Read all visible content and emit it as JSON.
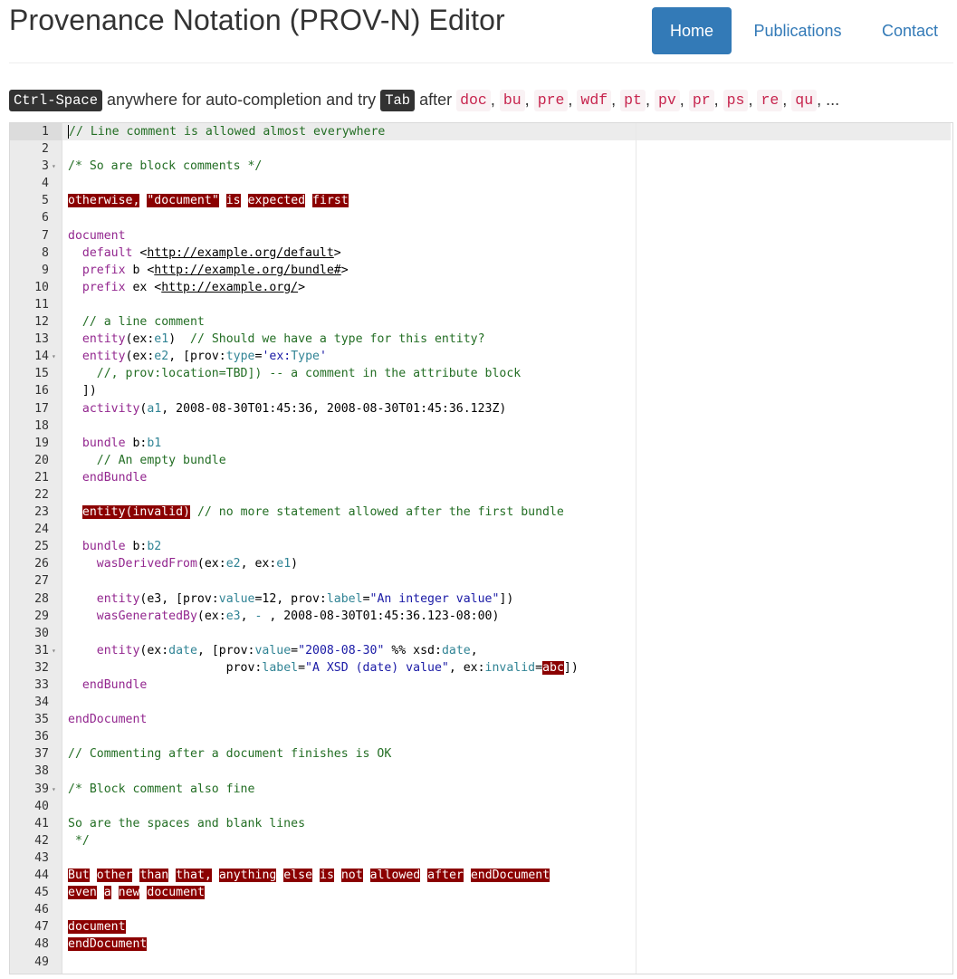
{
  "header": {
    "title": "Provenance Notation (PROV-N) Editor",
    "nav": [
      {
        "label": "Home",
        "active": true
      },
      {
        "label": "Publications",
        "active": false
      },
      {
        "label": "Contact",
        "active": false
      }
    ]
  },
  "hint": {
    "key1": "Ctrl-Space",
    "text1": " anywhere for auto-completion and try ",
    "key2": "Tab",
    "text2": " after ",
    "keywords": [
      "doc",
      "bu",
      "pre",
      "wdf",
      "pt",
      "pv",
      "pr",
      "ps",
      "re",
      "qu"
    ],
    "separator": ",",
    "ellipsis": "..."
  },
  "colors": {
    "accent": "#337ab7",
    "comment": "#236e24",
    "keyword": "#93278f",
    "property": "#318495",
    "string": "#1a1aa6",
    "error_bg": "#8b0000",
    "inline_code": "#c7254e"
  },
  "editor": {
    "fold_markers_on_lines": [
      3,
      14,
      31,
      39
    ],
    "lines": [
      [
        [
          "c",
          "// Line comment is allowed almost everywhere"
        ]
      ],
      [],
      [
        [
          "c",
          "/* So are block comments */"
        ]
      ],
      [],
      [
        [
          "e",
          "otherwise,"
        ],
        [
          "",
          " "
        ],
        [
          "e",
          "\"document\""
        ],
        [
          "",
          " "
        ],
        [
          "e",
          "is"
        ],
        [
          "",
          " "
        ],
        [
          "e",
          "expected"
        ],
        [
          "",
          " "
        ],
        [
          "e",
          "first"
        ]
      ],
      [],
      [
        [
          "k",
          "document"
        ]
      ],
      [
        [
          "",
          "  "
        ],
        [
          "k",
          "default"
        ],
        [
          "",
          " <"
        ],
        [
          "u",
          "http://example.org/default"
        ],
        [
          "",
          ">"
        ]
      ],
      [
        [
          "",
          "  "
        ],
        [
          "k",
          "prefix"
        ],
        [
          "",
          " b <"
        ],
        [
          "u",
          "http://example.org/bundle#"
        ],
        [
          "",
          ">"
        ]
      ],
      [
        [
          "",
          "  "
        ],
        [
          "k",
          "prefix"
        ],
        [
          "",
          " ex <"
        ],
        [
          "u",
          "http://example.org/"
        ],
        [
          "",
          ">"
        ]
      ],
      [],
      [
        [
          "",
          "  "
        ],
        [
          "c",
          "// a line comment"
        ]
      ],
      [
        [
          "",
          "  "
        ],
        [
          "k",
          "entity"
        ],
        [
          "",
          "(ex:"
        ],
        [
          "p",
          "e1"
        ],
        [
          "",
          ")  "
        ],
        [
          "c",
          "// Should we have a type for this entity?"
        ]
      ],
      [
        [
          "",
          "  "
        ],
        [
          "k",
          "entity"
        ],
        [
          "",
          "(ex:"
        ],
        [
          "p",
          "e2"
        ],
        [
          "",
          ", [prov:"
        ],
        [
          "p",
          "type"
        ],
        [
          "",
          "="
        ],
        [
          "s",
          "'ex:"
        ],
        [
          "p",
          "Type"
        ],
        [
          "s",
          "'"
        ]
      ],
      [
        [
          "",
          "    "
        ],
        [
          "c",
          "//, prov:location=TBD]) -- a comment in the attribute block"
        ]
      ],
      [
        [
          "",
          "  ])"
        ]
      ],
      [
        [
          "",
          "  "
        ],
        [
          "k",
          "activity"
        ],
        [
          "",
          "("
        ],
        [
          "p",
          "a1"
        ],
        [
          "",
          ", 2008-08-30T01:45:36, 2008-08-30T01:45:36.123Z)"
        ]
      ],
      [],
      [
        [
          "",
          "  "
        ],
        [
          "k",
          "bundle"
        ],
        [
          "",
          " b:"
        ],
        [
          "p",
          "b1"
        ]
      ],
      [
        [
          "",
          "    "
        ],
        [
          "c",
          "// An empty bundle"
        ]
      ],
      [
        [
          "",
          "  "
        ],
        [
          "k",
          "endBundle"
        ]
      ],
      [],
      [
        [
          "",
          "  "
        ],
        [
          "e",
          "entity(invalid)"
        ],
        [
          "",
          " "
        ],
        [
          "c",
          "// no more statement allowed after the first bundle"
        ]
      ],
      [],
      [
        [
          "",
          "  "
        ],
        [
          "k",
          "bundle"
        ],
        [
          "",
          " b:"
        ],
        [
          "p",
          "b2"
        ]
      ],
      [
        [
          "",
          "    "
        ],
        [
          "k",
          "wasDerivedFrom"
        ],
        [
          "",
          "(ex:"
        ],
        [
          "p",
          "e2"
        ],
        [
          "",
          ", ex:"
        ],
        [
          "p",
          "e1"
        ],
        [
          "",
          ")"
        ]
      ],
      [],
      [
        [
          "",
          "    "
        ],
        [
          "k",
          "entity"
        ],
        [
          "",
          "(e3, [prov:"
        ],
        [
          "p",
          "value"
        ],
        [
          "",
          "=12, prov:"
        ],
        [
          "p",
          "label"
        ],
        [
          "",
          "="
        ],
        [
          "s",
          "\"An integer value\""
        ],
        [
          "",
          "])"
        ]
      ],
      [
        [
          "",
          "    "
        ],
        [
          "k",
          "wasGeneratedBy"
        ],
        [
          "",
          "(ex:"
        ],
        [
          "p",
          "e3"
        ],
        [
          "",
          ", "
        ],
        [
          "p",
          "-"
        ],
        [
          "",
          " , 2008-08-30T01:45:36.123-08:00)"
        ]
      ],
      [],
      [
        [
          "",
          "    "
        ],
        [
          "k",
          "entity"
        ],
        [
          "",
          "(ex:"
        ],
        [
          "p",
          "date"
        ],
        [
          "",
          ", [prov:"
        ],
        [
          "p",
          "value"
        ],
        [
          "",
          "="
        ],
        [
          "s",
          "\"2008-08-30\""
        ],
        [
          "",
          " %% xsd:"
        ],
        [
          "p",
          "date"
        ],
        [
          "",
          ","
        ]
      ],
      [
        [
          "",
          "                      prov:"
        ],
        [
          "p",
          "label"
        ],
        [
          "",
          "="
        ],
        [
          "s",
          "\"A XSD (date) value\""
        ],
        [
          "",
          ", ex:"
        ],
        [
          "p",
          "invalid"
        ],
        [
          "",
          "="
        ],
        [
          "e",
          "abc"
        ],
        [
          "",
          "])"
        ]
      ],
      [
        [
          "",
          "  "
        ],
        [
          "k",
          "endBundle"
        ]
      ],
      [],
      [
        [
          "k",
          "endDocument"
        ]
      ],
      [],
      [
        [
          "c",
          "// Commenting after a document finishes is OK"
        ]
      ],
      [],
      [
        [
          "c",
          "/* Block comment also fine"
        ]
      ],
      [],
      [
        [
          "c",
          "So are the spaces and blank lines"
        ]
      ],
      [
        [
          "c",
          " */"
        ]
      ],
      [],
      [
        [
          "e",
          "But"
        ],
        [
          "",
          " "
        ],
        [
          "e",
          "other"
        ],
        [
          "",
          " "
        ],
        [
          "e",
          "than"
        ],
        [
          "",
          " "
        ],
        [
          "e",
          "that,"
        ],
        [
          "",
          " "
        ],
        [
          "e",
          "anything"
        ],
        [
          "",
          " "
        ],
        [
          "e",
          "else"
        ],
        [
          "",
          " "
        ],
        [
          "e",
          "is"
        ],
        [
          "",
          " "
        ],
        [
          "e",
          "not"
        ],
        [
          "",
          " "
        ],
        [
          "e",
          "allowed"
        ],
        [
          "",
          " "
        ],
        [
          "e",
          "after"
        ],
        [
          "",
          " "
        ],
        [
          "e",
          "endDocument"
        ]
      ],
      [
        [
          "e",
          "even"
        ],
        [
          "",
          " "
        ],
        [
          "e",
          "a"
        ],
        [
          "",
          " "
        ],
        [
          "e",
          "new"
        ],
        [
          "",
          " "
        ],
        [
          "e",
          "document"
        ]
      ],
      [],
      [
        [
          "e",
          "document"
        ]
      ],
      [
        [
          "e",
          "endDocument"
        ]
      ],
      []
    ]
  }
}
